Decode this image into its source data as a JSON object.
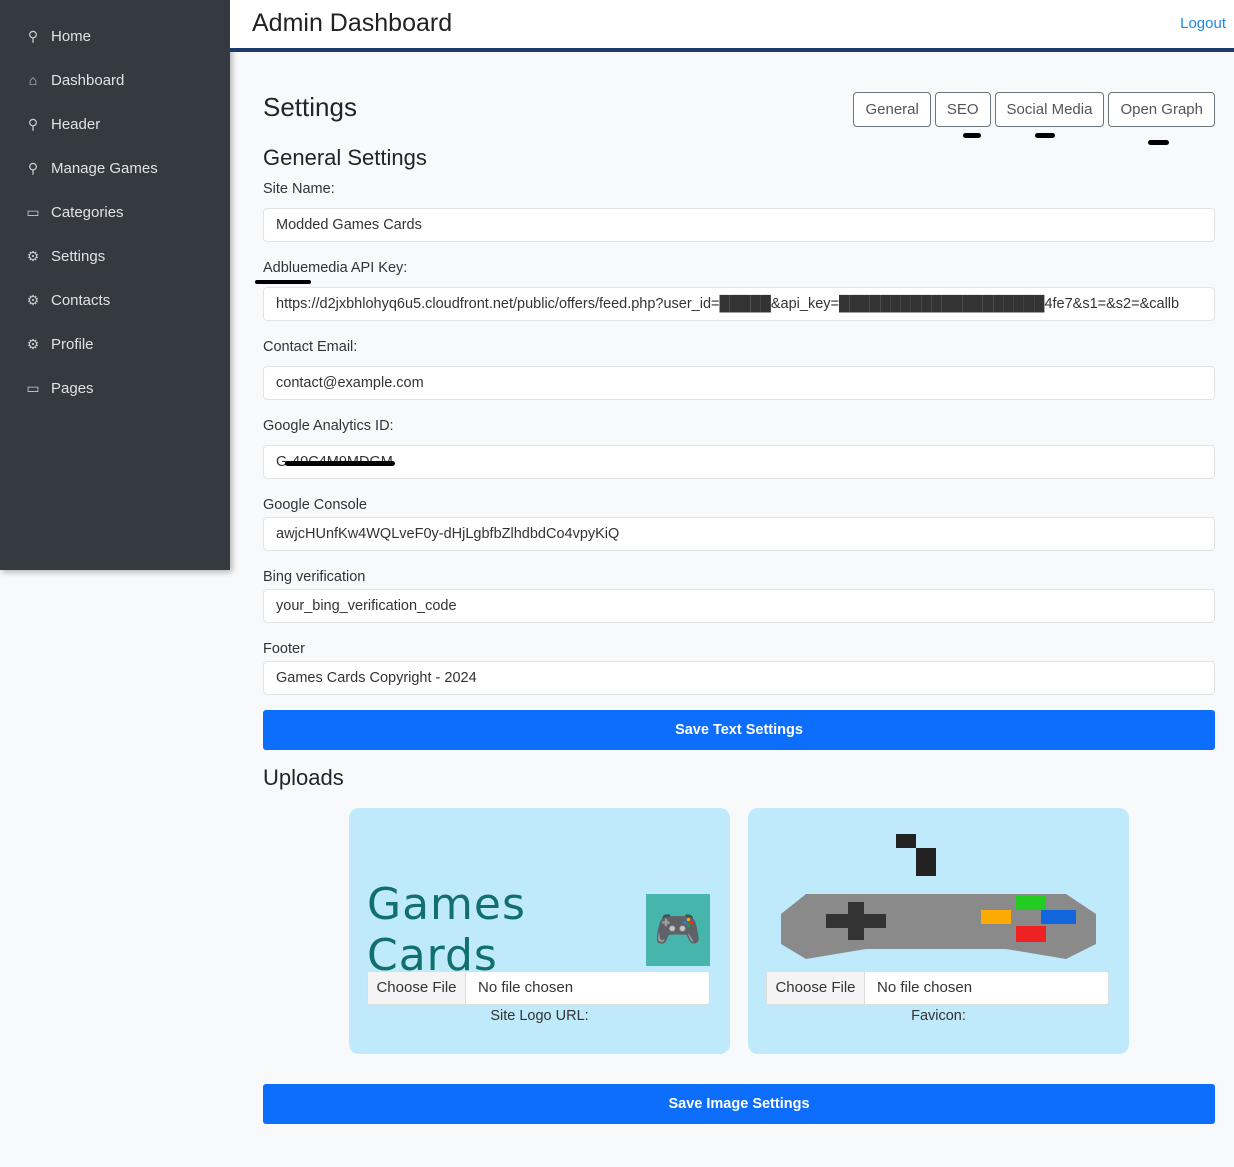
{
  "sidebar": {
    "items": [
      {
        "label": "Home",
        "icon": "joystick-icon"
      },
      {
        "label": "Dashboard",
        "icon": "home-icon"
      },
      {
        "label": "Header",
        "icon": "joystick-icon"
      },
      {
        "label": "Manage Games",
        "icon": "joystick-icon"
      },
      {
        "label": "Categories",
        "icon": "folder-icon"
      },
      {
        "label": "Settings",
        "icon": "gear-icon"
      },
      {
        "label": "Contacts",
        "icon": "gear-icon"
      },
      {
        "label": "Profile",
        "icon": "gear-icon"
      },
      {
        "label": "Pages",
        "icon": "folder-icon"
      }
    ]
  },
  "header": {
    "title": "Admin Dashboard",
    "logout": "Logout"
  },
  "settings": {
    "title": "Settings",
    "tabs": [
      "General",
      "SEO",
      "Social Media",
      "Open Graph"
    ],
    "section": "General Settings",
    "fields": [
      {
        "label": "Site Name:",
        "value": "Modded Games Cards"
      },
      {
        "label": "Adbluemedia API Key:",
        "value": "https://d2jxbhlohyq6u5.cloudfront.net/public/offers/feed.php?user_id=█████&api_key=████████████████████4fe7&s1=&s2=&callb"
      },
      {
        "label": "Contact Email:",
        "value": "contact@example.com"
      },
      {
        "label": "Google Analytics ID:",
        "value": "G-40C4M9MDGM"
      },
      {
        "label": "Google Console",
        "value": "awjcHUnfKw4WQLveF0y-dHjLgbfbZlhdbdCo4vpyKiQ"
      },
      {
        "label": "Bing verification",
        "value": "your_bing_verification_code"
      },
      {
        "label": "Footer",
        "value": "Games Cards Copyright - 2024"
      }
    ],
    "save_text": "Save Text Settings"
  },
  "uploads": {
    "title": "Uploads",
    "logo_text": "Games Cards",
    "choose": "Choose File",
    "no_file": "No file chosen",
    "logo_caption": "Site Logo URL:",
    "favicon_caption": "Favicon:",
    "save_images": "Save Image Settings"
  },
  "colors": {
    "primary": "#0d6efd",
    "sidebar": "#343a40",
    "card": "#bfeafb"
  }
}
